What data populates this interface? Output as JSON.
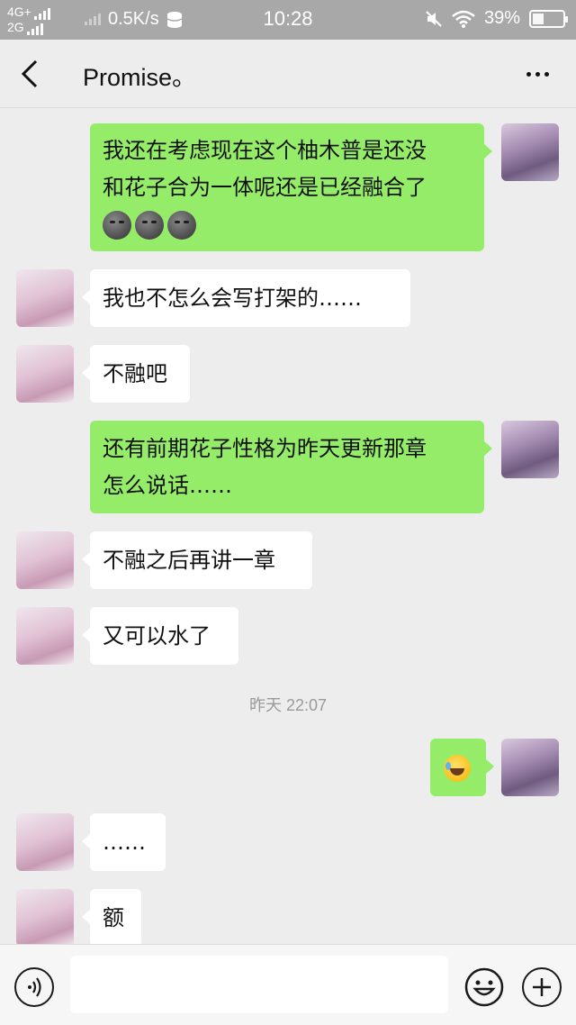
{
  "status_bar": {
    "network_top": "4G+",
    "network_bottom": "2G",
    "speed": "0.5K/s",
    "time": "10:28",
    "battery": "39%",
    "battery_level": 0.39
  },
  "header": {
    "title": "Promise。",
    "back_icon": "chevron-left-icon",
    "more_icon": "more-dots-icon"
  },
  "messages": [
    {
      "side": "right",
      "lines": [
        "我还在考虑现在这个柚木普是还没",
        "和花子合为一体呢还是已经融合了"
      ],
      "emoji": "new-moon-face x3"
    },
    {
      "side": "left",
      "text": "我也不怎么会写打架的……"
    },
    {
      "side": "left",
      "text": "不融吧"
    },
    {
      "side": "right",
      "lines": [
        "还有前期花子性格为昨天更新那章",
        "怎么说话……"
      ]
    },
    {
      "side": "left",
      "text": "不融之后再讲一章"
    },
    {
      "side": "left",
      "text": "又可以水了"
    },
    {
      "side": "right",
      "emoji": "laughing-crying-face"
    },
    {
      "side": "left",
      "text": "……"
    },
    {
      "side": "left",
      "text": "额"
    }
  ],
  "timestamp": "昨天 22:07",
  "input_bar": {
    "voice_icon": "voice-icon",
    "emoji_icon": "emoji-icon",
    "plus_icon": "plus-icon",
    "input_value": ""
  }
}
